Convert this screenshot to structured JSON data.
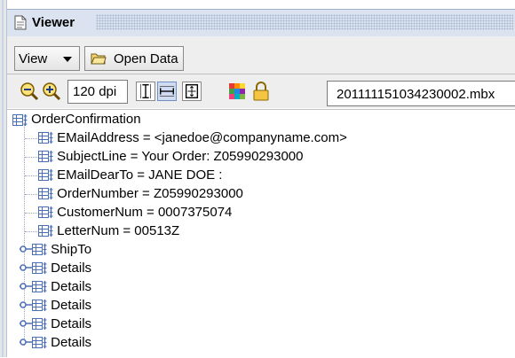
{
  "window": {
    "title": "Viewer"
  },
  "toolbar": {
    "view_label": "View",
    "open_data_label": "Open Data",
    "dpi_value": "120 dpi",
    "file_name": "201111151034230002.mbx",
    "icons": [
      "zoom-out-icon",
      "zoom-in-icon",
      "fit-height-icon",
      "fit-width-icon",
      "fit-page-icon",
      "color-palette-icon",
      "lock-icon"
    ]
  },
  "tree": {
    "root": "OrderConfirmation",
    "children": [
      "EMailAddress = <janedoe@companyname.com>",
      "SubjectLine = Your Order: Z05990293000",
      "EMailDearTo = JANE DOE :",
      "OrderNumber = Z05990293000",
      "CustomerNum = 0007375074",
      "LetterNum = 00513Z",
      "ShipTo",
      "Details",
      "Details",
      "Details",
      "Details",
      "Details"
    ]
  },
  "colors": {
    "titlebar": "#dbe3f0",
    "toolbar": "#eeeeee",
    "node_icon": "#4a6fb5",
    "palette": [
      "#e53935",
      "#fb8c00",
      "#fdd835",
      "#43a047",
      "#1e88e5",
      "#8e24aa",
      "#ec407a",
      "#00acc1",
      "#7cb342"
    ]
  }
}
